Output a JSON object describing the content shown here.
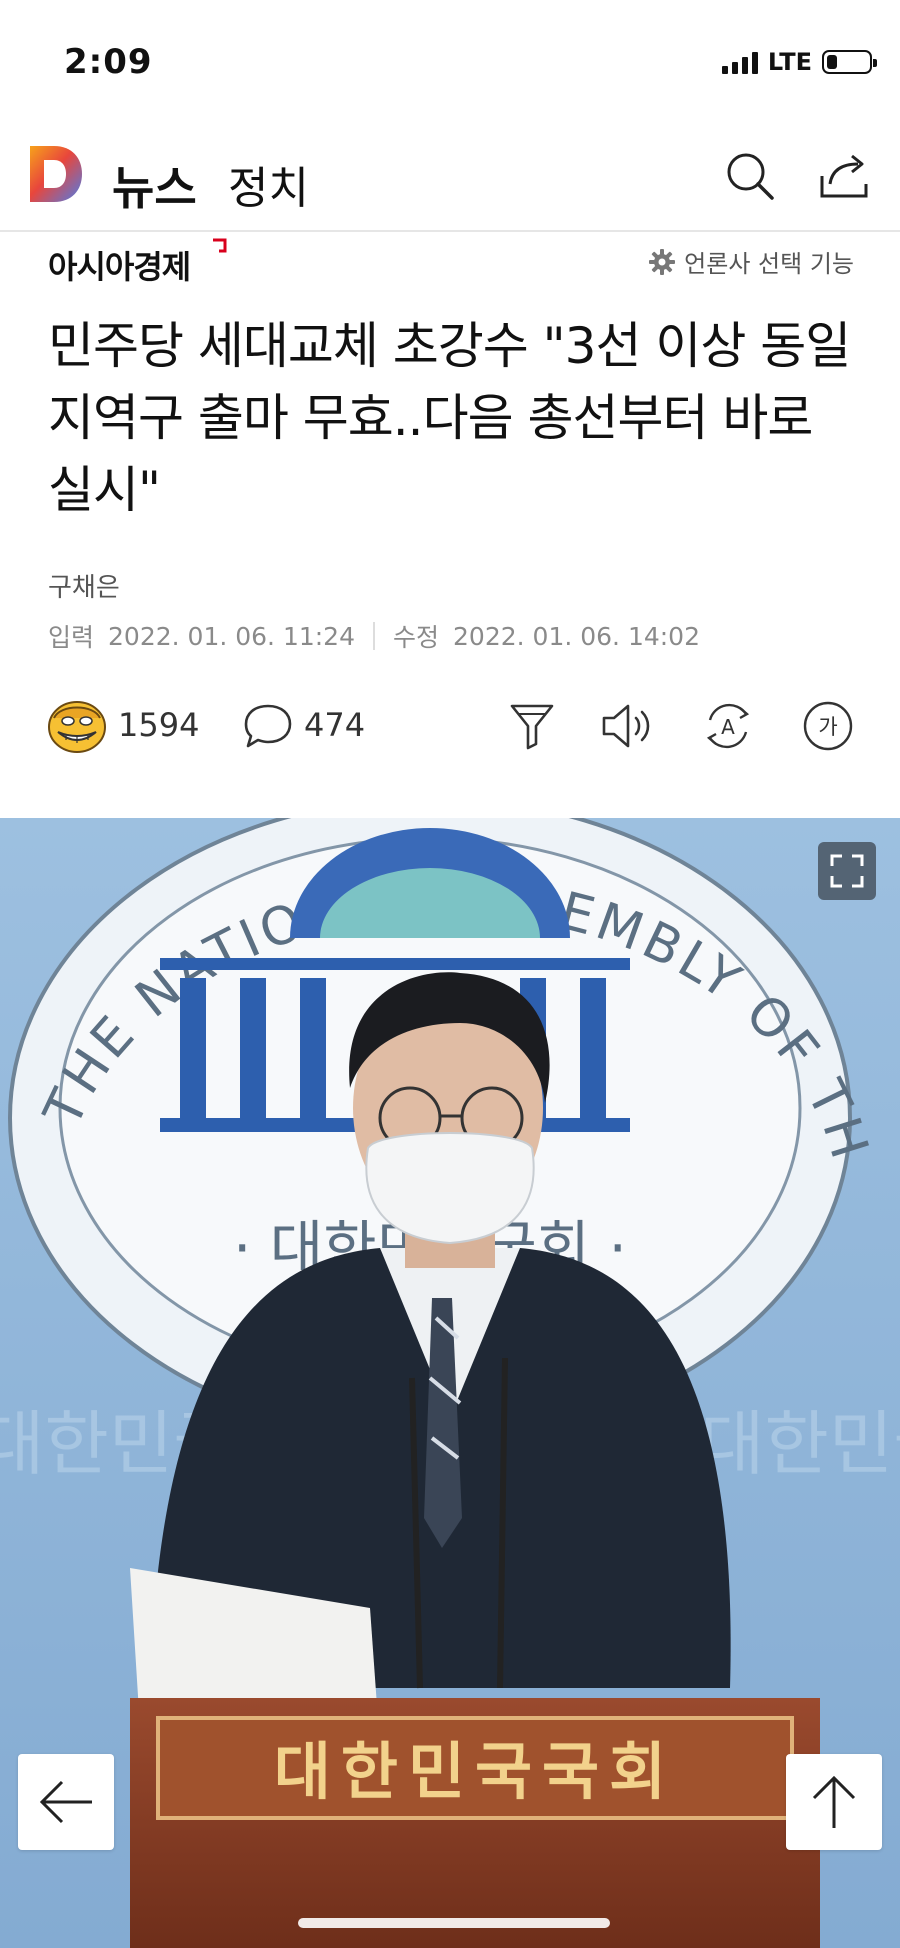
{
  "status_bar": {
    "time": "2:09",
    "network": "LTE",
    "battery_level": 0.25
  },
  "header": {
    "app_name": "뉴스",
    "section": "정치",
    "brand_colors": [
      "#f7a21b",
      "#e8463c",
      "#4c7de8",
      "#3bb67e"
    ]
  },
  "press": {
    "name": "아시아경제",
    "select_label": "언론사 선택 기능",
    "mark_color": "#d8001c"
  },
  "article": {
    "headline": "민주당 세대교체 초강수 \"3선 이상 동일 지역구 출마 무효..다음 총선부터 바로 실시\"",
    "reporter": "구채은",
    "published_label": "입력",
    "published": "2022. 01. 06. 11:24",
    "modified_label": "수정",
    "modified": "2022. 01. 06. 14:02"
  },
  "actions": {
    "reaction_count": "1594",
    "comment_count": "474",
    "icons": [
      "emoji-face-icon",
      "comment-icon",
      "summary-icon",
      "tts-icon",
      "translate-icon",
      "font-size-icon"
    ],
    "font_size_glyph": "가",
    "translate_glyph": "A"
  },
  "photo": {
    "emblem_text": "THE NATIONAL ASSEMBLY OF THE REPUBLIC OF KOREA",
    "emblem_korean": "· 대한민국국회 ·",
    "podium_text": "대한민국국회",
    "background_word": "대한민국국회"
  }
}
